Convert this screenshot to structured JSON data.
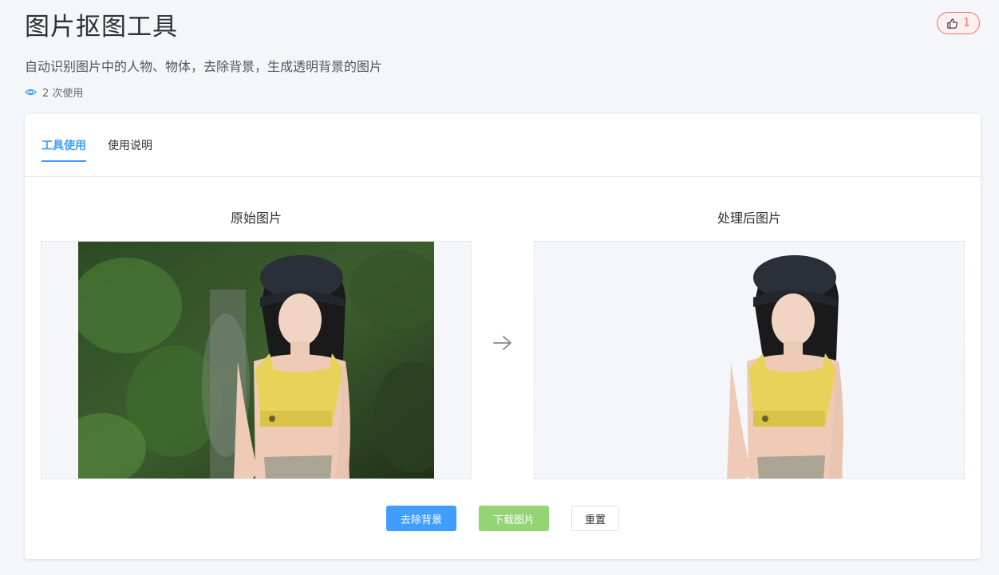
{
  "page": {
    "title": "图片抠图工具",
    "subtitle": "自动识别图片中的人物、物体，去除背景，生成透明背景的图片",
    "usage_text": "2 次使用",
    "like_count": "1"
  },
  "tabs": [
    {
      "label": "工具使用",
      "active": true
    },
    {
      "label": "使用说明",
      "active": false
    }
  ],
  "panels": {
    "original_title": "原始图片",
    "processed_title": "处理后图片"
  },
  "buttons": {
    "remove_bg": "去除背景",
    "download": "下载图片",
    "reset": "重置"
  },
  "colors": {
    "primary": "#409eff",
    "success_disabled": "#95d475",
    "like": "#f56c6c"
  }
}
